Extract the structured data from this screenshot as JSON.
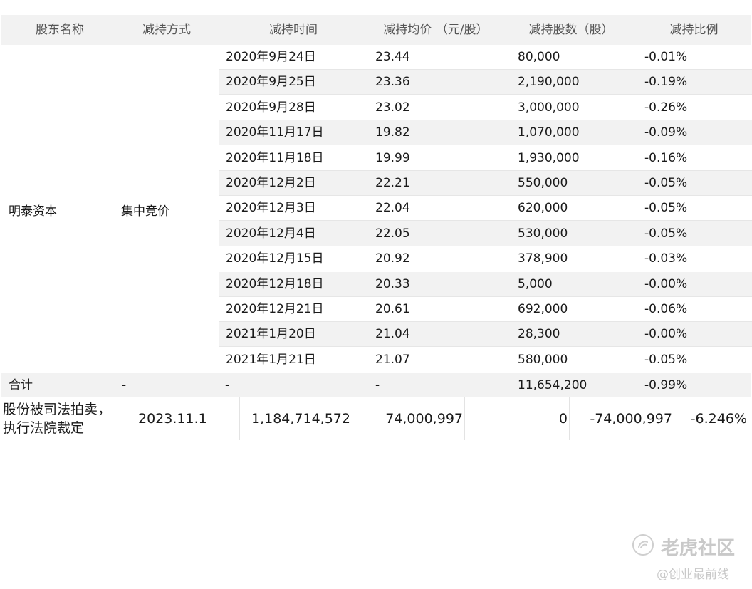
{
  "table": {
    "headers": [
      "股东名称",
      "减持方式",
      "减持时间",
      "减持均价 （元/股）",
      "减持股数（股）",
      "减持比例"
    ],
    "shareholder": "明泰资本",
    "method": "集中竞价",
    "rows": [
      {
        "date": "2020年9月24日",
        "price": "23.44",
        "shares": "80,000",
        "ratio": "-0.01%"
      },
      {
        "date": "2020年9月25日",
        "price": "23.36",
        "shares": "2,190,000",
        "ratio": "-0.19%"
      },
      {
        "date": "2020年9月28日",
        "price": "23.02",
        "shares": "3,000,000",
        "ratio": "-0.26%"
      },
      {
        "date": "2020年11月17日",
        "price": "19.82",
        "shares": "1,070,000",
        "ratio": "-0.09%"
      },
      {
        "date": "2020年11月18日",
        "price": "19.99",
        "shares": "1,930,000",
        "ratio": "-0.16%"
      },
      {
        "date": "2020年12月2日",
        "price": "22.21",
        "shares": "550,000",
        "ratio": "-0.05%"
      },
      {
        "date": "2020年12月3日",
        "price": "22.04",
        "shares": "620,000",
        "ratio": "-0.05%"
      },
      {
        "date": "2020年12月4日",
        "price": "22.05",
        "shares": "530,000",
        "ratio": "-0.05%"
      },
      {
        "date": "2020年12月15日",
        "price": "20.92",
        "shares": "378,900",
        "ratio": "-0.03%"
      },
      {
        "date": "2020年12月18日",
        "price": "20.33",
        "shares": "5,000",
        "ratio": "-0.00%"
      },
      {
        "date": "2020年12月21日",
        "price": "20.61",
        "shares": "692,000",
        "ratio": "-0.06%"
      },
      {
        "date": "2021年1月20日",
        "price": "21.04",
        "shares": "28,300",
        "ratio": "-0.00%"
      },
      {
        "date": "2021年1月21日",
        "price": "21.07",
        "shares": "580,000",
        "ratio": "-0.05%"
      }
    ],
    "total": {
      "label": "合计",
      "method": "-",
      "date": "-",
      "price": "-",
      "shares": "11,654,200",
      "ratio": "-0.99%"
    }
  },
  "judicial_row": {
    "reason_line1": "股份被司法拍卖，",
    "reason_line2": "执行法院裁定",
    "date": "2023.11.1",
    "col3": "1,184,714,572",
    "col4": "74,000,997",
    "col5": "0",
    "col6": "-74,000,997",
    "col7": "-6.246%"
  },
  "watermark": {
    "brand": "老虎社区",
    "handle": "@创业最前线"
  }
}
